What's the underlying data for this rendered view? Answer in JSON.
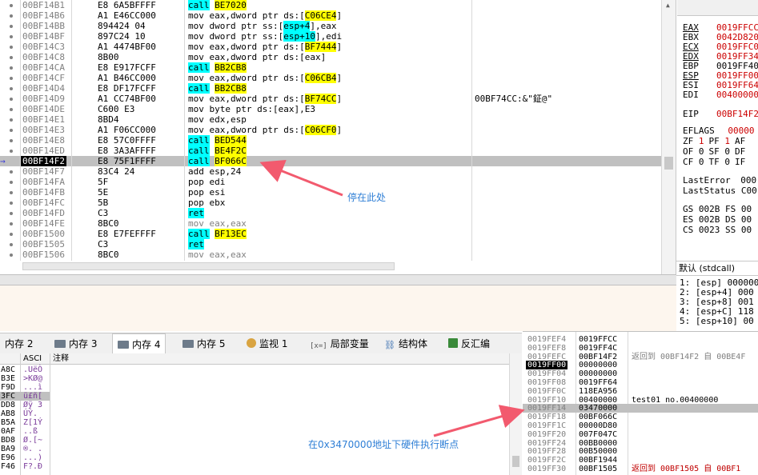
{
  "disasm": {
    "rows": [
      {
        "addr": "00BF14B1",
        "bytes": "E8 6A5BFFFF",
        "mn": "call",
        "kind": "call",
        "op": "BE7020",
        "cmt": ""
      },
      {
        "addr": "00BF14B6",
        "bytes": "A1 E46CC000",
        "mn": "mov",
        "kind": "movds",
        "pre": "eax,dword ptr ds:[",
        "mem": "C06CE4",
        "post": "]",
        "cmt": ""
      },
      {
        "addr": "00BF14BB",
        "bytes": "894424 04",
        "mn": "mov",
        "kind": "movss",
        "pre": "dword ptr ss:[",
        "mem": "esp+4",
        "post": "],eax",
        "cmt": ""
      },
      {
        "addr": "00BF14BF",
        "bytes": "897C24 10",
        "mn": "mov",
        "kind": "movss",
        "pre": "dword ptr ss:[",
        "mem": "esp+10",
        "post": "],edi",
        "cmt": ""
      },
      {
        "addr": "00BF14C3",
        "bytes": "A1 4474BF00",
        "mn": "mov",
        "kind": "movds",
        "pre": "eax,dword ptr ds:[",
        "mem": "BF7444",
        "post": "]",
        "cmt": ""
      },
      {
        "addr": "00BF14C8",
        "bytes": "8B00",
        "mn": "mov",
        "kind": "plain",
        "text": "eax,dword ptr ds:[eax]",
        "cmt": ""
      },
      {
        "addr": "00BF14CA",
        "bytes": "E8 E917FCFF",
        "mn": "call",
        "kind": "call",
        "op": "BB2CB8",
        "cmt": ""
      },
      {
        "addr": "00BF14CF",
        "bytes": "A1 B46CC000",
        "mn": "mov",
        "kind": "movds",
        "pre": "eax,dword ptr ds:[",
        "mem": "C06CB4",
        "post": "]",
        "cmt": ""
      },
      {
        "addr": "00BF14D4",
        "bytes": "E8 DF17FCFF",
        "mn": "call",
        "kind": "call",
        "op": "BB2CB8",
        "cmt": ""
      },
      {
        "addr": "00BF14D9",
        "bytes": "A1 CC74BF00",
        "mn": "mov",
        "kind": "movds",
        "pre": "eax,dword ptr ds:[",
        "mem": "BF74CC",
        "post": "]",
        "cmt": "00BF74CC:&\"鉦@\""
      },
      {
        "addr": "00BF14DE",
        "bytes": "C600 E3",
        "mn": "mov",
        "kind": "plain",
        "text": "byte ptr ds:[eax],E3",
        "cmt": ""
      },
      {
        "addr": "00BF14E1",
        "bytes": "8BD4",
        "mn": "mov",
        "kind": "plain",
        "text": "edx,esp",
        "cmt": ""
      },
      {
        "addr": "00BF14E3",
        "bytes": "A1 F06CC000",
        "mn": "mov",
        "kind": "movds",
        "pre": "eax,dword ptr ds:[",
        "mem": "C06CF0",
        "post": "]",
        "cmt": ""
      },
      {
        "addr": "00BF14E8",
        "bytes": "E8 57C0FFFF",
        "mn": "call",
        "kind": "call",
        "op": "BED544",
        "cmt": ""
      },
      {
        "addr": "00BF14ED",
        "bytes": "E8 3A3AFFFF",
        "mn": "call",
        "kind": "call",
        "op": "BE4F2C",
        "cmt": ""
      },
      {
        "addr": "00BF14F2",
        "bytes": "E8 75F1FFFF",
        "mn": "call",
        "kind": "call",
        "op": "BF066C",
        "cmt": "",
        "current": true
      },
      {
        "addr": "00BF14F7",
        "bytes": "83C4 24",
        "mn": "add",
        "kind": "plain",
        "text": "esp,24",
        "cmt": ""
      },
      {
        "addr": "00BF14FA",
        "bytes": "5F",
        "mn": "pop",
        "kind": "plain",
        "text": "edi",
        "cmt": ""
      },
      {
        "addr": "00BF14FB",
        "bytes": "5E",
        "mn": "pop",
        "kind": "plain",
        "text": "esi",
        "cmt": ""
      },
      {
        "addr": "00BF14FC",
        "bytes": "5B",
        "mn": "pop",
        "kind": "plain",
        "text": "ebx",
        "cmt": ""
      },
      {
        "addr": "00BF14FD",
        "bytes": "C3",
        "mn": "ret",
        "kind": "ret",
        "cmt": ""
      },
      {
        "addr": "00BF14FE",
        "bytes": "8BC0",
        "mn": "mov",
        "kind": "gray",
        "text": "eax,eax",
        "cmt": ""
      },
      {
        "addr": "00BF1500",
        "bytes": "E8 E7FEFFFF",
        "mn": "call",
        "kind": "call",
        "op": "BF13EC",
        "cmt": ""
      },
      {
        "addr": "00BF1505",
        "bytes": "C3",
        "mn": "ret",
        "kind": "ret",
        "cmt": ""
      },
      {
        "addr": "00BF1506",
        "bytes": "8BC0",
        "mn": "mov",
        "kind": "gray",
        "text": "eax,eax",
        "cmt": ""
      }
    ],
    "current_arrow": "→"
  },
  "registers": [
    {
      "name": "EAX",
      "value": "0019FFCC",
      "red": true,
      "underline": true
    },
    {
      "name": "EBX",
      "value": "0042D820",
      "red": true,
      "underline": false
    },
    {
      "name": "ECX",
      "value": "0019FFC0",
      "red": true,
      "underline": true
    },
    {
      "name": "EDX",
      "value": "0019FF34",
      "red": true,
      "underline": true
    },
    {
      "name": "EBP",
      "value": "0019FF40",
      "red": false,
      "underline": false
    },
    {
      "name": "ESP",
      "value": "0019FF00",
      "red": true,
      "underline": true
    },
    {
      "name": "ESI",
      "value": "0019FF64",
      "red": true,
      "underline": false
    },
    {
      "name": "EDI",
      "value": "00400000",
      "red": true,
      "underline": false
    },
    {
      "name": "EIP",
      "value": "00BF14F2",
      "red": true,
      "underline": false
    }
  ],
  "flags": {
    "eflags_label": "EFLAGS",
    "eflags_value": "00000",
    "line1": [
      "ZF",
      "1",
      "PF",
      "1",
      "AF"
    ],
    "line2": [
      "OF",
      "0",
      "SF",
      "0",
      "DF"
    ],
    "line3": [
      "CF",
      "0",
      "TF",
      "0",
      "IF"
    ]
  },
  "errors": {
    "lasterror_label": "LastError",
    "lasterror_value": "000",
    "laststatus_label": "LastStatus",
    "laststatus_value": "C00"
  },
  "segments": [
    "GS 002B  FS 00",
    "ES 002B  DS 00",
    "CS 0023  SS 00"
  ],
  "callconv": "默认 (stdcall)",
  "args": [
    "1: [esp] 000000",
    "2: [esp+4] 000",
    "3: [esp+8] 001",
    "4: [esp+C] 118",
    "5: [esp+10] 00"
  ],
  "tabs": [
    {
      "label": "内存 2",
      "icon": "memory-icon",
      "active": false
    },
    {
      "label": "内存 3",
      "icon": "memory-icon",
      "active": false
    },
    {
      "label": "内存 4",
      "icon": "memory-icon",
      "active": true
    },
    {
      "label": "内存 5",
      "icon": "memory-icon",
      "active": false
    },
    {
      "label": "监视 1",
      "icon": "watch-icon",
      "active": false
    },
    {
      "label": "局部变量",
      "icon": "locals-icon",
      "active": false
    },
    {
      "label": "结构体",
      "icon": "struct-icon",
      "active": false
    },
    {
      "label": "反汇编",
      "icon": "disasm-icon",
      "active": false
    }
  ],
  "locals_icon_text": "[x=]",
  "dump": {
    "col_ascii": "ASCI",
    "col_comment": "注释",
    "rows": [
      {
        "addr": "A8C",
        "ascii": ".UëÒ"
      },
      {
        "addr": "B3E",
        "ascii": ">KØ@"
      },
      {
        "addr": "F9D",
        "ascii": "...ì"
      },
      {
        "addr": "3FC",
        "ascii": "ü£ñ[",
        "selected": true
      },
      {
        "addr": "DD8",
        "ascii": "Øÿ 3"
      },
      {
        "addr": "AB8",
        "ascii": "  ÚÝ."
      },
      {
        "addr": "B5A",
        "ascii": "Z[1Ý"
      },
      {
        "addr": "0AF",
        "ascii": "  ..ß"
      },
      {
        "addr": "BD8",
        "ascii": "Ø.[~"
      },
      {
        "addr": "BA9",
        "ascii": "®.  ."
      },
      {
        "addr": "E96",
        "ascii": "...)"
      },
      {
        "addr": "F46",
        "ascii": "F?.Ð"
      }
    ]
  },
  "stack": {
    "rows": [
      {
        "addr": "0019FEF4",
        "val": "0019FFCC",
        "cmt": "",
        "cmtClass": ""
      },
      {
        "addr": "0019FEF8",
        "val": "0019FF4C",
        "cmt": "",
        "cmtClass": ""
      },
      {
        "addr": "0019FEFC",
        "val": "00BF14F2",
        "cmt": "返回到 00BF14F2 自 00BE4F",
        "cmtClass": ""
      },
      {
        "addr": "0019FF00",
        "val": "00000000",
        "cmt": "",
        "cmtClass": "",
        "top": true
      },
      {
        "addr": "0019FF04",
        "val": "00000000",
        "cmt": "",
        "cmtClass": ""
      },
      {
        "addr": "0019FF08",
        "val": "0019FF64",
        "cmt": "",
        "cmtClass": ""
      },
      {
        "addr": "0019FF0C",
        "val": "118EA956",
        "cmt": "",
        "cmtClass": ""
      },
      {
        "addr": "0019FF10",
        "val": "00400000",
        "cmt": "test01_no.00400000",
        "cmtClass": "blk"
      },
      {
        "addr": "0019FF14",
        "val": "03470000",
        "cmt": "",
        "cmtClass": "",
        "hl": true
      },
      {
        "addr": "0019FF18",
        "val": "00BF066C",
        "cmt": "",
        "cmtClass": ""
      },
      {
        "addr": "0019FF1C",
        "val": "00000D80",
        "cmt": "",
        "cmtClass": ""
      },
      {
        "addr": "0019FF20",
        "val": "007F047C",
        "cmt": "",
        "cmtClass": ""
      },
      {
        "addr": "0019FF24",
        "val": "00BB0000",
        "cmt": "",
        "cmtClass": ""
      },
      {
        "addr": "0019FF28",
        "val": "00B50000",
        "cmt": "",
        "cmtClass": ""
      },
      {
        "addr": "0019FF2C",
        "val": "00BF1944",
        "cmt": "",
        "cmtClass": ""
      },
      {
        "addr": "0019FF30",
        "val": "00BF1505",
        "cmt": "返回到 00BF1505 自 00BF1",
        "cmtClass": "red"
      }
    ]
  },
  "annotations": {
    "stop_here": "停在此处",
    "hw_break": "在0x3470000地址下硬件执行断点"
  },
  "colors": {
    "annotation": "#2f7fd6",
    "arrow": "#f25a6e",
    "call_highlight": "#00ffff",
    "target_highlight": "#ffff00",
    "current_row": "#c0c0c0"
  }
}
